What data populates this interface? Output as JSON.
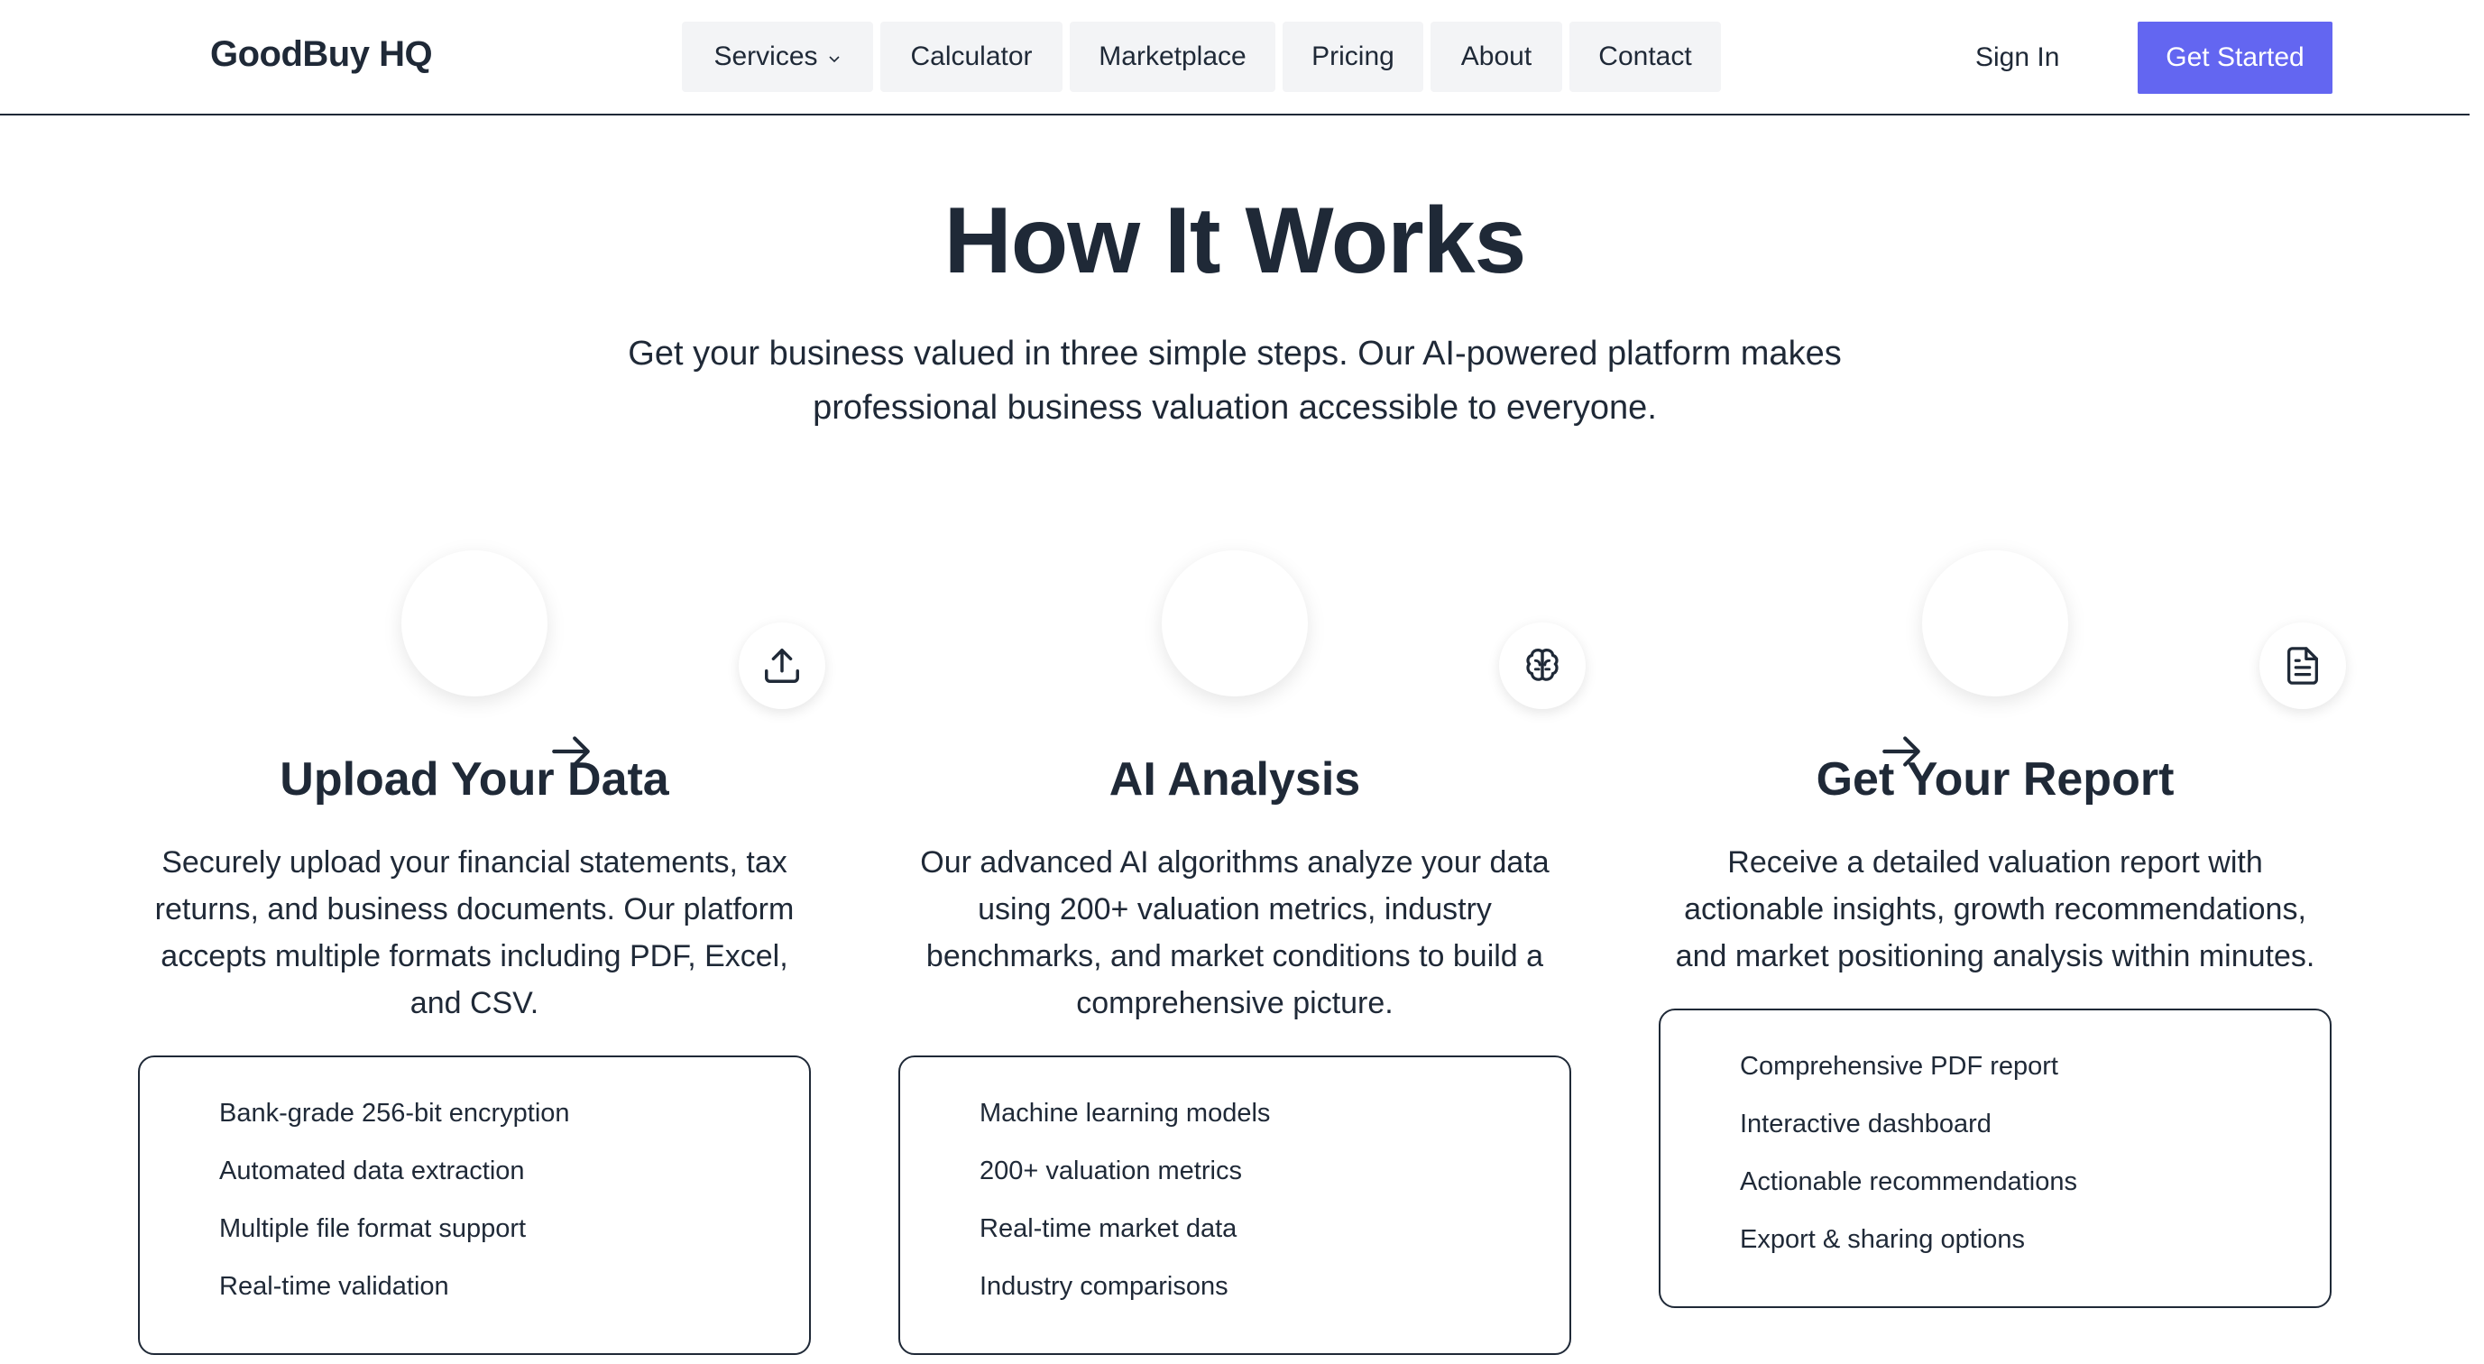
{
  "header": {
    "logo": "GoodBuy HQ",
    "nav": [
      {
        "label": "Services",
        "has_dropdown": true
      },
      {
        "label": "Calculator"
      },
      {
        "label": "Marketplace"
      },
      {
        "label": "Pricing"
      },
      {
        "label": "About"
      },
      {
        "label": "Contact"
      }
    ],
    "sign_in": "Sign In",
    "get_started": "Get Started"
  },
  "colors": {
    "accent": "#6366f1",
    "text": "#1f2937",
    "nav_bg": "#f3f4f6"
  },
  "hero": {
    "title": "How It Works",
    "subtitle": "Get your business valued in three simple steps. Our AI-powered platform makes professional business valuation accessible to everyone."
  },
  "steps": [
    {
      "icon": "upload-icon",
      "title": "Upload Your Data",
      "description": "Securely upload your financial statements, tax returns, and business documents. Our platform accepts multiple formats including PDF, Excel, and CSV.",
      "features": [
        "Bank-grade 256-bit encryption",
        "Automated data extraction",
        "Multiple file format support",
        "Real-time validation"
      ]
    },
    {
      "icon": "brain-icon",
      "title": "AI Analysis",
      "description": "Our advanced AI algorithms analyze your data using 200+ valuation metrics, industry benchmarks, and market conditions to build a comprehensive picture.",
      "features": [
        "Machine learning models",
        "200+ valuation metrics",
        "Real-time market data",
        "Industry comparisons"
      ]
    },
    {
      "icon": "document-icon",
      "title": "Get Your Report",
      "description": "Receive a detailed valuation report with actionable insights, growth recommendations, and market positioning analysis within minutes.",
      "features": [
        "Comprehensive PDF report",
        "Interactive dashboard",
        "Actionable recommendations",
        "Export & sharing options"
      ]
    }
  ]
}
